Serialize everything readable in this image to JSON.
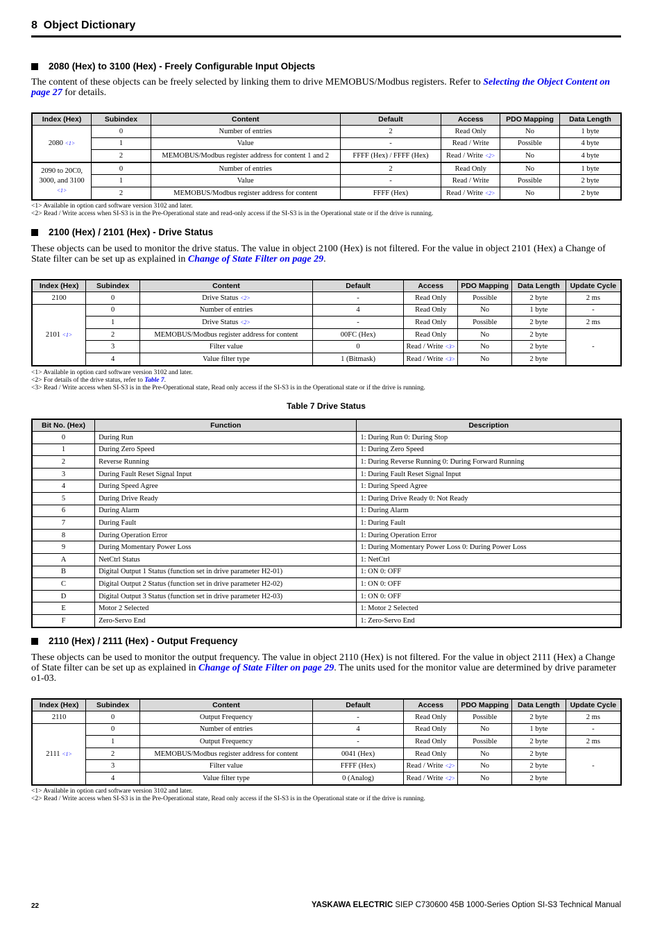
{
  "chapter": {
    "number": "8",
    "title": "Object Dictionary"
  },
  "section1": {
    "heading": "2080 (Hex) to 3100 (Hex) - Freely Configurable Input Objects",
    "para_text": "The content of these objects can be freely selected by linking them to drive MEMOBUS/Modbus registers. Refer to ",
    "para_link": "Selecting the Object Content on page 27",
    "para_tail": " for details.",
    "table": {
      "headers": [
        "Index (Hex)",
        "Subindex",
        "Content",
        "Default",
        "Access",
        "PDO Mapping",
        "Data Length"
      ],
      "groups": [
        {
          "index": "2080",
          "ref": "<1>",
          "rows": [
            {
              "sub": "0",
              "content": "Number of entries",
              "default": "2",
              "access": "Read Only",
              "access_ref": "",
              "pdo": "No",
              "length": "1 byte"
            },
            {
              "sub": "1",
              "content": "Value",
              "default": "-",
              "access": "Read / Write",
              "access_ref": "",
              "pdo": "Possible",
              "length": "4 byte"
            },
            {
              "sub": "2",
              "content": "MEMOBUS/Modbus register address for content 1 and 2",
              "default": "FFFF (Hex) / FFFF (Hex)",
              "access": "Read / Write",
              "access_ref": "<2>",
              "pdo": "No",
              "length": "4 byte"
            }
          ]
        },
        {
          "index": "2090 to 20C0, 3000, and 3100",
          "ref": "<1>",
          "rows": [
            {
              "sub": "0",
              "content": "Number of entries",
              "default": "2",
              "access": "Read Only",
              "access_ref": "",
              "pdo": "No",
              "length": "1 byte"
            },
            {
              "sub": "1",
              "content": "Value",
              "default": "-",
              "access": "Read / Write",
              "access_ref": "",
              "pdo": "Possible",
              "length": "2 byte"
            },
            {
              "sub": "2",
              "content": "MEMOBUS/Modbus register address for content",
              "default": "FFFF (Hex)",
              "access": "Read / Write",
              "access_ref": "<2>",
              "pdo": "No",
              "length": "2 byte"
            }
          ]
        }
      ]
    },
    "notes": [
      "<1> Available in option card software version 3102 and later.",
      "<2> Read / Write access when SI-S3 is in the Pre-Operational state and read-only access if the SI-S3 is in the Operational state or if the drive is running."
    ]
  },
  "section2": {
    "heading": "2100 (Hex) / 2101 (Hex) - Drive Status",
    "para_text": "These objects can be used to monitor the drive status. The value in object 2100 (Hex) is not filtered. For the value in object 2101 (Hex) a Change of State filter can be set up as explained in ",
    "para_link": "Change of State Filter on page 29",
    "para_tail": ".",
    "table": {
      "headers": [
        "Index (Hex)",
        "Subindex",
        "Content",
        "Default",
        "Access",
        "PDO Mapping",
        "Data Length",
        "Update Cycle"
      ],
      "rows": [
        {
          "index": "2100",
          "index_ref": "",
          "sub": "0",
          "content": "Drive Status",
          "content_ref": "<2>",
          "default": "-",
          "access": "Read Only",
          "access_ref": "",
          "pdo": "Possible",
          "length": "2 byte",
          "cycle": "2 ms"
        },
        {
          "index": "2101",
          "index_ref": "<1>",
          "sub": "0",
          "content": "Number of entries",
          "content_ref": "",
          "default": "4",
          "access": "Read Only",
          "access_ref": "",
          "pdo": "No",
          "length": "1 byte",
          "cycle": "-"
        },
        {
          "sub": "1",
          "content": "Drive Status",
          "content_ref": "<2>",
          "default": "-",
          "access": "Read Only",
          "access_ref": "",
          "pdo": "Possible",
          "length": "2 byte",
          "cycle": "2 ms"
        },
        {
          "sub": "2",
          "content": "MEMOBUS/Modbus register address for content",
          "content_ref": "",
          "default": "00FC (Hex)",
          "access": "Read Only",
          "access_ref": "",
          "pdo": "No",
          "length": "2 byte",
          "cycle": "-"
        },
        {
          "sub": "3",
          "content": "Filter value",
          "content_ref": "",
          "default": "0",
          "access": "Read / Write",
          "access_ref": "<3>",
          "pdo": "No",
          "length": "2 byte"
        },
        {
          "sub": "4",
          "content": "Value filter type",
          "content_ref": "",
          "default": "1 (Bitmask)",
          "access": "Read / Write",
          "access_ref": "<3>",
          "pdo": "No",
          "length": "2 byte"
        }
      ]
    },
    "notes": {
      "n1": "<1> Available in option card software version 3102 and later.",
      "n2_text": "<2> For details of the drive status, refer to ",
      "n2_link": "Table 7",
      "n2_tail": ".",
      "n3": "<3> Read / Write access when SI-S3 is in the Pre-Operational state, Read only access if the SI-S3 is in the Operational state or if the drive is running."
    }
  },
  "table7": {
    "caption": "Table 7  Drive Status",
    "headers": [
      "Bit No. (Hex)",
      "Function",
      "Description"
    ],
    "rows": [
      {
        "bit": "0",
        "function": "During Run",
        "description": "1: During Run 0: During Stop"
      },
      {
        "bit": "1",
        "function": "During Zero Speed",
        "description": "1: During Zero Speed"
      },
      {
        "bit": "2",
        "function": "Reverse Running",
        "description": "1: During Reverse Running 0: During Forward Running"
      },
      {
        "bit": "3",
        "function": "During Fault Reset Signal Input",
        "description": "1: During Fault Reset Signal Input"
      },
      {
        "bit": "4",
        "function": "During Speed Agree",
        "description": "1: During Speed Agree"
      },
      {
        "bit": "5",
        "function": "During Drive Ready",
        "description": "1: During Drive Ready 0: Not Ready"
      },
      {
        "bit": "6",
        "function": "During Alarm",
        "description": "1: During Alarm"
      },
      {
        "bit": "7",
        "function": "During Fault",
        "description": "1: During Fault"
      },
      {
        "bit": "8",
        "function": "During Operation Error",
        "description": "1: During Operation Error"
      },
      {
        "bit": "9",
        "function": "During Momentary Power Loss",
        "description": "1: During Momentary Power Loss 0: During Power Loss"
      },
      {
        "bit": "A",
        "function": "NetCtrl Status",
        "description": "1: NetCtrl"
      },
      {
        "bit": "B",
        "function": "Digital Output 1 Status (function set in drive parameter H2-01)",
        "description": "1: ON 0: OFF"
      },
      {
        "bit": "C",
        "function": "Digital Output 2 Status (function set in drive parameter H2-02)",
        "description": "1: ON 0: OFF"
      },
      {
        "bit": "D",
        "function": "Digital Output 3 Status (function set in drive parameter H2-03)",
        "description": "1: ON 0: OFF"
      },
      {
        "bit": "E",
        "function": "Motor 2 Selected",
        "description": "1: Motor 2 Selected"
      },
      {
        "bit": "F",
        "function": "Zero-Servo End",
        "description": "1: Zero-Servo End"
      }
    ]
  },
  "section3": {
    "heading": "2110 (Hex) / 2111 (Hex) - Output Frequency",
    "para_text": "These objects can be used to monitor the output frequency. The value in object 2110 (Hex) is not filtered. For the value in object 2111 (Hex) a Change of State filter can be set up as explained in ",
    "para_link": "Change of State Filter on page 29",
    "para_tail": ". The units used for the monitor value are determined by drive parameter o1-03.",
    "table": {
      "headers": [
        "Index (Hex)",
        "Subindex",
        "Content",
        "Default",
        "Access",
        "PDO Mapping",
        "Data Length",
        "Update Cycle"
      ],
      "rows": [
        {
          "index": "2110",
          "index_ref": "",
          "sub": "0",
          "content": "Output Frequency",
          "default": "-",
          "access": "Read Only",
          "access_ref": "",
          "pdo": "Possible",
          "length": "2 byte",
          "cycle": "2 ms"
        },
        {
          "index": "2111",
          "index_ref": "<1>",
          "sub": "0",
          "content": "Number of entries",
          "default": "4",
          "access": "Read Only",
          "access_ref": "",
          "pdo": "No",
          "length": "1 byte",
          "cycle": "-"
        },
        {
          "sub": "1",
          "content": "Output Frequency",
          "default": "-",
          "access": "Read Only",
          "access_ref": "",
          "pdo": "Possible",
          "length": "2 byte",
          "cycle": "2 ms"
        },
        {
          "sub": "2",
          "content": "MEMOBUS/Modbus register address for content",
          "default": "0041 (Hex)",
          "access": "Read Only",
          "access_ref": "",
          "pdo": "No",
          "length": "2 byte",
          "cycle": "-"
        },
        {
          "sub": "3",
          "content": "Filter value",
          "default": "FFFF (Hex)",
          "access": "Read / Write",
          "access_ref": "<2>",
          "pdo": "No",
          "length": "2 byte"
        },
        {
          "sub": "4",
          "content": "Value filter type",
          "default": "0 (Analog)",
          "access": "Read / Write",
          "access_ref": "<2>",
          "pdo": "No",
          "length": "2 byte"
        }
      ]
    },
    "notes": [
      "<1> Available in option card software version 3102 and later.",
      "<2> Read / Write access when SI-S3 is in the Pre-Operational state, Read only access if the SI-S3 is in the Operational state or if the drive is running."
    ]
  },
  "footer": {
    "page_number": "22",
    "brand": "YASKAWA ELECTRIC",
    "manual": " SIEP C730600 45B 1000-Series Option SI-S3 Technical Manual"
  }
}
